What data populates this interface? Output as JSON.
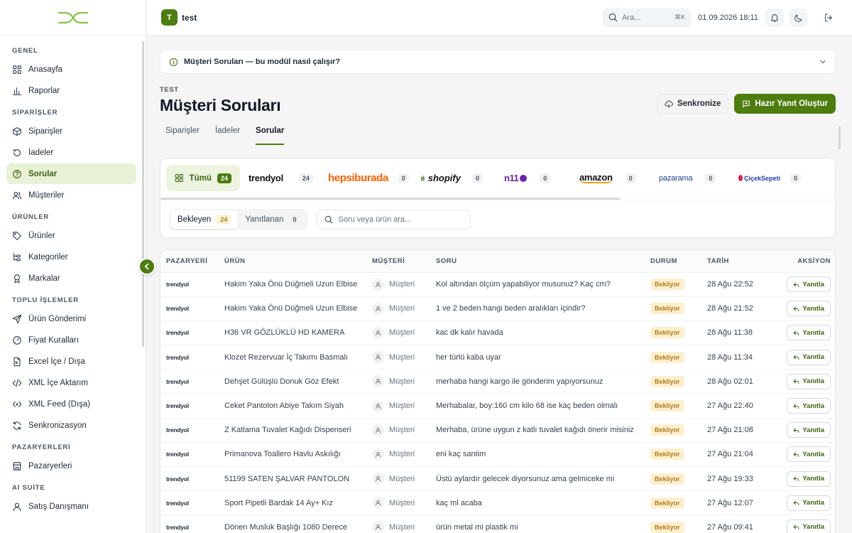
{
  "topbar": {
    "workspace_initial": "T",
    "workspace_name": "test",
    "search_placeholder": "Ara...",
    "search_shortcut": "⌘K",
    "datetime": "01.09.2026 18:11"
  },
  "sidebar": {
    "groups": [
      {
        "title": "GENEL",
        "items": [
          {
            "label": "Anasayfa",
            "icon": "grid-icon"
          },
          {
            "label": "Raporlar",
            "icon": "bar-chart-icon"
          }
        ]
      },
      {
        "title": "SİPARİŞLER",
        "items": [
          {
            "label": "Siparişler",
            "icon": "box-icon"
          },
          {
            "label": "İadeler",
            "icon": "rotate-icon"
          },
          {
            "label": "Sorular",
            "icon": "help-circle-icon",
            "active": true
          },
          {
            "label": "Müşteriler",
            "icon": "users-icon"
          }
        ]
      },
      {
        "title": "ÜRÜNLER",
        "items": [
          {
            "label": "Ürünler",
            "icon": "tag-icon"
          },
          {
            "label": "Kategoriler",
            "icon": "tree-icon"
          },
          {
            "label": "Markalar",
            "icon": "award-icon"
          }
        ]
      },
      {
        "title": "TOPLU İŞLEMLER",
        "items": [
          {
            "label": "Ürün Gönderimi",
            "icon": "send-icon"
          },
          {
            "label": "Fiyat Kuralları",
            "icon": "gauge-icon"
          },
          {
            "label": "Excel İçe / Dışa",
            "icon": "file-icon"
          },
          {
            "label": "XML İçe Aktarım",
            "icon": "code-icon"
          },
          {
            "label": "XML Feed (Dışa)",
            "icon": "feed-icon"
          },
          {
            "label": "Senkronizasyon",
            "icon": "refresh-icon"
          }
        ]
      },
      {
        "title": "PAZARYERLERİ",
        "items": [
          {
            "label": "Pazaryerleri",
            "icon": "store-icon"
          }
        ]
      },
      {
        "title": "AI SUİTE",
        "items": [
          {
            "label": "Satış Danışmanı",
            "icon": "user-icon"
          }
        ]
      }
    ]
  },
  "info_bar": {
    "text": "Müşteri Soruları — bu modül nasıl çalışır?"
  },
  "header": {
    "workspace_label": "TEST",
    "title": "Müşteri Soruları",
    "sync_button": "Senkronize",
    "primary_button": "Hazır Yanıt Oluştur"
  },
  "tabs": [
    {
      "label": "Siparişler"
    },
    {
      "label": "İadeler"
    },
    {
      "label": "Sorular",
      "active": true
    }
  ],
  "marketplaces": {
    "all_label": "Tümü",
    "all_count": "24",
    "items": [
      {
        "name": "trendyol",
        "count": "24"
      },
      {
        "name": "hepsiburada",
        "count": "0"
      },
      {
        "name": "shopify",
        "count": "0"
      },
      {
        "name": "n11",
        "count": "0"
      },
      {
        "name": "amazon",
        "count": "0"
      },
      {
        "name": "pazarama",
        "count": "0"
      },
      {
        "name": "ÇiçekSepeti",
        "count": "0"
      }
    ]
  },
  "filters": {
    "pending_label": "Bekleyen",
    "pending_count": "24",
    "answered_label": "Yanıtlanan",
    "answered_count": "0",
    "search_placeholder": "Soru veya ürün ara..."
  },
  "table": {
    "columns": [
      "PAZARYERİ",
      "ÜRÜN",
      "MÜŞTERİ",
      "SORU",
      "DURUM",
      "TARİH",
      "AKSİYON"
    ],
    "rows": [
      {
        "product": "Hakim Yaka Önü Düğmeli Uzun Elbise",
        "customer": "Müşteri",
        "question": "Kol altından ölçüm yapabiliyor musunuz? Kaç cm?",
        "status": "Bekliyor",
        "date": "28 Ağu 22:52"
      },
      {
        "product": "Hakim Yaka Önü Düğmeli Uzun Elbise",
        "customer": "Müşteri",
        "question": "1 ve 2 beden hangi beden aralıkları içindir?",
        "status": "Bekliyor",
        "date": "28 Ağu 21:52"
      },
      {
        "product": "H36 VR GÖZLÜKLÜ HD KAMERA",
        "customer": "Müşteri",
        "question": "kac dk kalır havada",
        "status": "Bekliyor",
        "date": "28 Ağu 11:38"
      },
      {
        "product": "Klozet Rezervuar İç Takımı Basmalı",
        "customer": "Müşteri",
        "question": "her türlü kaba uyar",
        "status": "Bekliyor",
        "date": "28 Ağu 11:34"
      },
      {
        "product": "Dehşet Gülüşlü Donuk Göz Efekt",
        "customer": "Müşteri",
        "question": "merhaba hangi kargo ile gönderim yapıyorsunuz",
        "status": "Bekliyor",
        "date": "28 Ağu 02:01"
      },
      {
        "product": "Ceket Pantolon Abiye Takım Siyah",
        "customer": "Müşteri",
        "question": "Merhabalar, boy:160 cm kilo 68 ise kaç beden olmalı",
        "status": "Bekliyor",
        "date": "27 Ağu 22:40"
      },
      {
        "product": "Z Katlama Tuvalet Kağıdı Dispenseri",
        "customer": "Müşteri",
        "question": "Merhaba, ürüne uygun z katlı tuvalet kağıdı önerir misiniz",
        "status": "Bekliyor",
        "date": "27 Ağu 21:08"
      },
      {
        "product": "Primanova Toallero Havlu Askılığı",
        "customer": "Müşteri",
        "question": "eni kaç santim",
        "status": "Bekliyor",
        "date": "27 Ağu 21:04"
      },
      {
        "product": "51199 SATEN ŞALVAR PANTOLON",
        "customer": "Müşteri",
        "question": "Üstü aylardır gelecek diyorsunuz ama gelmiceke mi",
        "status": "Bekliyor",
        "date": "27 Ağu 19:33"
      },
      {
        "product": "Sport Pipetli Bardak 14 Ay+ Kız",
        "customer": "Müşteri",
        "question": "kaç ml acaba",
        "status": "Bekliyor",
        "date": "27 Ağu 12:07"
      },
      {
        "product": "Dönen Musluk Başlığı 1080 Derece",
        "customer": "Müşteri",
        "question": "ürün metal mi plastik mi",
        "status": "Bekliyor",
        "date": "27 Ağu 09:41"
      }
    ],
    "reply_label": "Yanıtla"
  },
  "colors": {
    "accent": "#4d7c0f",
    "accent_light": "#e8f2d6",
    "pending_badge": "#fdf0cf",
    "trendyol_orange": "#f27a1a",
    "hepsiburada_orange": "#ff6000"
  }
}
